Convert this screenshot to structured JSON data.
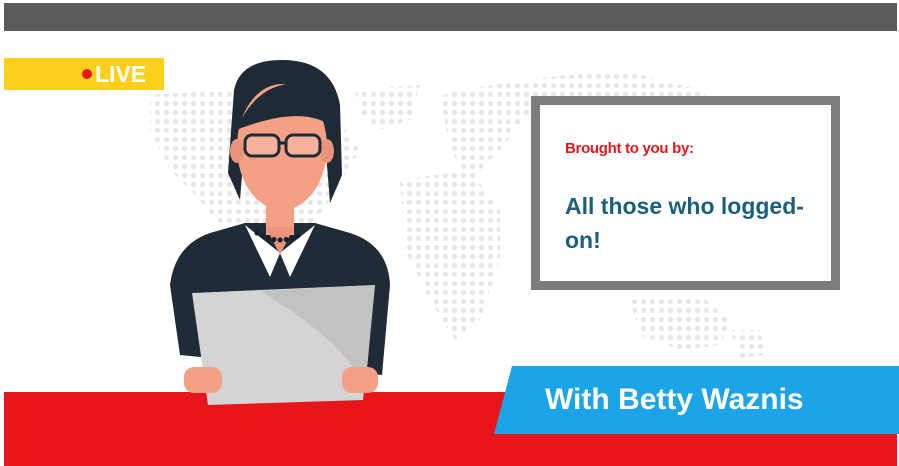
{
  "live_badge": {
    "text": "LIVE",
    "color": "#fbd01d",
    "dot_color": "#e8161b"
  },
  "info_box": {
    "small_text": "Brought to you by:",
    "big_text": "All those who logged-on!",
    "border_color": "#7b7b7b",
    "small_text_color": "#e8161b",
    "big_text_color": "#1b5e7d"
  },
  "name_banner": {
    "text": "With Betty Waznis",
    "color": "#1da3e8"
  },
  "colors": {
    "top_bar": "#5b5b5b",
    "desk": "#e8161b",
    "map_dots": "#e6e6e6"
  },
  "icons": [
    "world-map-dots",
    "presenter-illustration",
    "live-dot-icon"
  ]
}
